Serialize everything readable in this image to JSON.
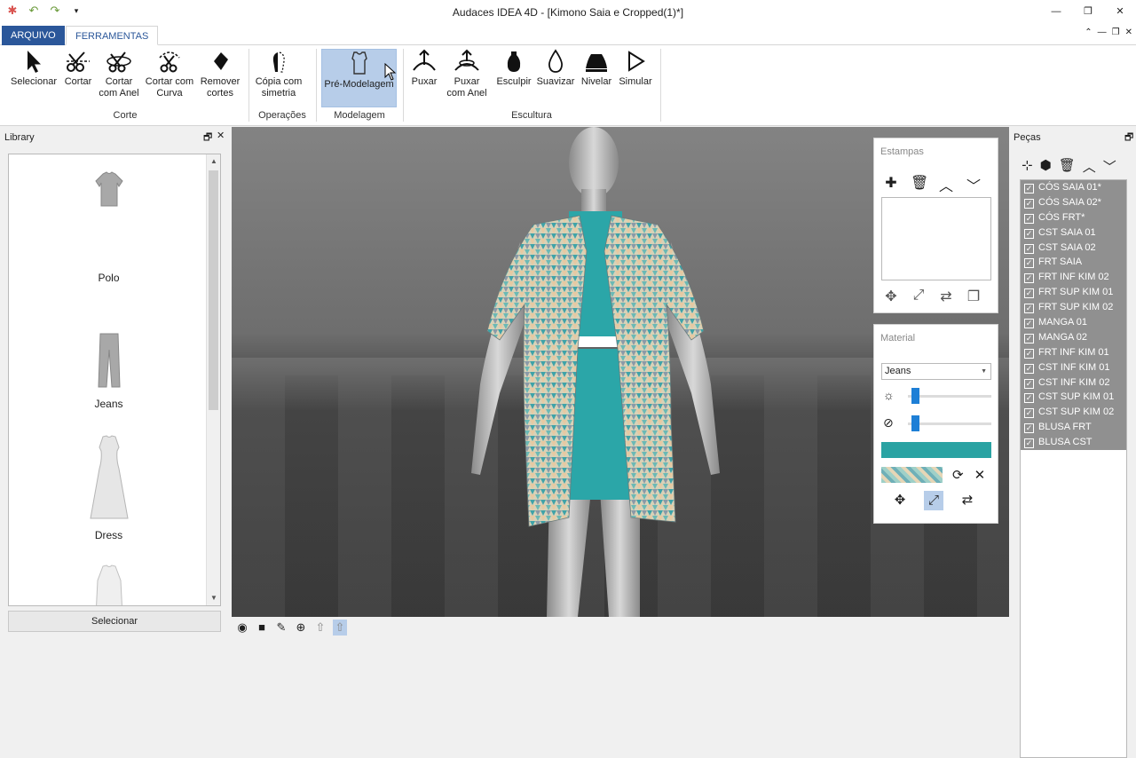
{
  "window": {
    "title": "Audaces IDEA 4D - [Kimono Saia e Cropped(1)*]",
    "quick_access": [
      "app-icon",
      "undo-icon",
      "redo-icon",
      "customize-icon"
    ],
    "controls": [
      "—",
      "❐",
      "✕"
    ],
    "mdi_controls": [
      "⌃",
      "—",
      "❐",
      "✕"
    ]
  },
  "ribbon": {
    "tabs": [
      "ARQUIVO",
      "FERRAMENTAS"
    ],
    "active_tab": "FERRAMENTAS",
    "groups": [
      {
        "label": "Corte",
        "buttons": [
          "Selecionar",
          "Cortar",
          "Cortar com Anel",
          "Cortar com Curva",
          "Remover cortes"
        ]
      },
      {
        "label": "Operações",
        "buttons": [
          "Cópia com simetria"
        ]
      },
      {
        "label": "Modelagem",
        "buttons": [
          "Pré-Modelagem"
        ]
      },
      {
        "label": "Escultura",
        "buttons": [
          "Puxar",
          "Puxar com Anel",
          "Esculpir",
          "Suavizar",
          "Nivelar",
          "Simular"
        ]
      }
    ],
    "active_button": "Pré-Modelagem"
  },
  "library": {
    "title": "Library",
    "items": [
      "",
      "Polo",
      "Jeans",
      "Dress"
    ],
    "select_label": "Selecionar"
  },
  "estampas": {
    "title": "Estampas",
    "tools": [
      "add-icon",
      "trash-icon",
      "up-icon",
      "down-icon"
    ],
    "transform_tools": [
      "move-icon",
      "scale-icon",
      "rotate-icon",
      "copy-icon"
    ]
  },
  "material": {
    "title": "Material",
    "selected": "Jeans",
    "brightness": 0.05,
    "transparency": 0.05,
    "color": "#2aa3a3"
  },
  "pecas": {
    "title": "Peças",
    "items": [
      "CÓS SAIA 01*",
      "CÓS SAIA 02*",
      "CÓS FRT*",
      "CST SAIA 01",
      "CST SAIA 02",
      "FRT SAIA",
      "FRT INF KIM 02",
      "FRT SUP KIM 01",
      "FRT SUP KIM 02",
      "MANGA 01",
      "MANGA 02",
      "FRT INF KIM 01",
      "CST INF KIM 01",
      "CST INF KIM 02",
      "CST SUP KIM 01",
      "CST SUP KIM 02",
      "BLUSA FRT",
      "BLUSA CST"
    ],
    "all_checked": true
  },
  "colors": {
    "accent": "#2b579a",
    "selection": "#b7cde9",
    "teal": "#2aa3a3",
    "list_bg": "#909090"
  }
}
